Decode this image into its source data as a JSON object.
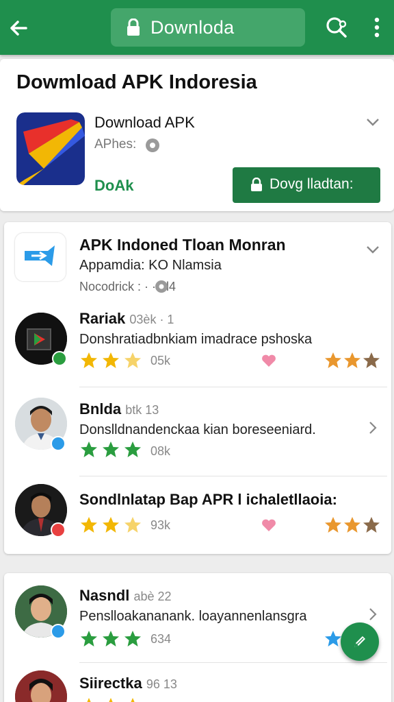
{
  "colors": {
    "brand": "#1f8f4d",
    "button": "#1f7a43",
    "star_gold": "#f2b705",
    "star_green": "#2a9d3f",
    "star_orange": "#e9972e",
    "heart": "#f08aa8"
  },
  "topbar": {
    "url_text": "Downloda",
    "icons": [
      "back-arrow-icon",
      "lock-icon",
      "search-chat-icon",
      "more-vert-icon"
    ]
  },
  "header_card": {
    "title": "Dowmload APK Indoresia",
    "app_name": "Download APK",
    "app_sub": "APhes:",
    "status": "DoAk",
    "button_label": "Dovg lladtan:"
  },
  "featured": {
    "title": "APK Indoned Tloan Monran",
    "subtitle": "Appamdia: KO Nlamsia",
    "meta": "Nocodrick : · · 1l4"
  },
  "reviews": [
    {
      "name": "Rariak",
      "meta": "03èk · 1",
      "text": "Donshratiadbnkiam imadrace pshoska",
      "stars": 3,
      "star_color": "gold",
      "count": "05k",
      "heart": true,
      "right_stars": 3,
      "badge": "green"
    },
    {
      "name": "Bnlda",
      "meta": "btk 13",
      "text": "Donslldnandenckaa kian boreseeniard.",
      "stars": 3,
      "star_color": "green",
      "count": "08k",
      "heart": false,
      "right_stars": 0,
      "badge": "blue"
    },
    {
      "name": "Sondlnlatap  Bap  APR l ichaletllaoia:",
      "meta": "",
      "text": "",
      "stars": 3,
      "star_color": "gold",
      "count": "93k",
      "heart": true,
      "right_stars": 3,
      "badge": "red"
    }
  ],
  "reviews2": [
    {
      "name": "Nasndl",
      "meta": "abè 22",
      "text": "Penslloakananank. loayannenlansgra",
      "stars": 3,
      "star_color": "green",
      "count": "634",
      "badge": "blue"
    },
    {
      "name": "Siirectka",
      "meta": "96 13",
      "text": "",
      "stars": 3,
      "star_color": "gold",
      "count": "",
      "badge": ""
    }
  ]
}
